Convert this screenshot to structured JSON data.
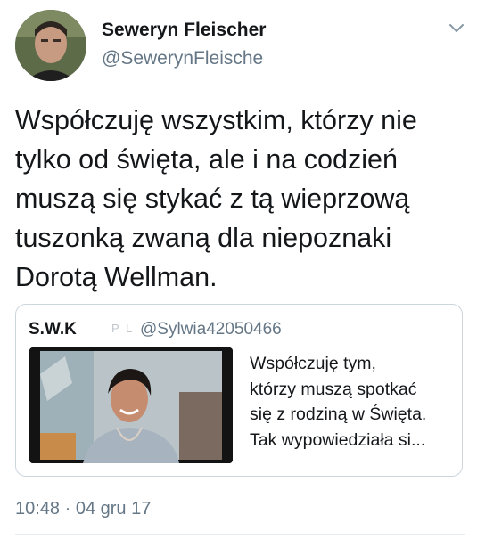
{
  "author": {
    "display_name": "Seweryn Fleischer",
    "handle": "@SewerynFleische"
  },
  "tweet": {
    "text_lines": [
      "Współczuję wszystkim, którzy nie",
      "tylko od święta, ale i na codzień",
      "muszą się stykać z tą wieprzową",
      "tuszonką zwaną dla niepoznaki",
      "Dorotą Wellman."
    ]
  },
  "quoted_tweet": {
    "display_name": "S.W.K",
    "badges": [
      "P",
      "L"
    ],
    "handle": "@Sylwia42050466",
    "text_lines": [
      "Współczuję tym,",
      "którzy muszą spotkać",
      "się z rodziną w Święta.",
      "Tak wypowiedziała si..."
    ]
  },
  "footer": {
    "timestamp": "10:48 · 04 gru 17"
  },
  "icons": {
    "menu": "chevron-down-icon"
  },
  "colors": {
    "secondary_text": "#657786",
    "border": "#ccd6dd"
  }
}
